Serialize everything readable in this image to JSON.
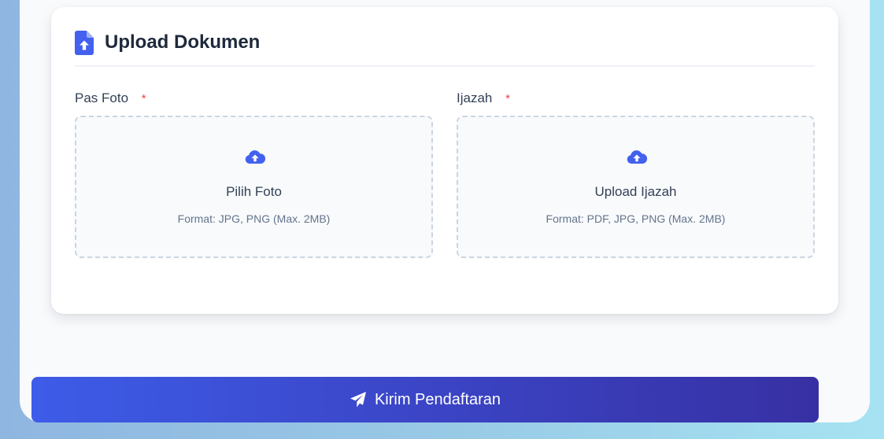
{
  "section": {
    "title": "Upload Dokumen",
    "icon": "file-upload-icon"
  },
  "fields": [
    {
      "label": "Pas Foto",
      "required_mark": "*",
      "dropzone_title": "Pilih Foto",
      "dropzone_hint": "Format: JPG, PNG (Max. 2MB)",
      "icon": "cloud-upload-icon"
    },
    {
      "label": "Ijazah",
      "required_mark": "*",
      "dropzone_title": "Upload Ijazah",
      "dropzone_hint": "Format: PDF, JPG, PNG (Max. 2MB)",
      "icon": "cloud-upload-icon"
    }
  ],
  "submit": {
    "label": "Kirim Pendaftaran",
    "icon": "paper-plane-icon"
  },
  "colors": {
    "accent": "#4361ee",
    "required": "#ef4444",
    "button_start": "#3d5ce8",
    "button_end": "#3730a3"
  }
}
